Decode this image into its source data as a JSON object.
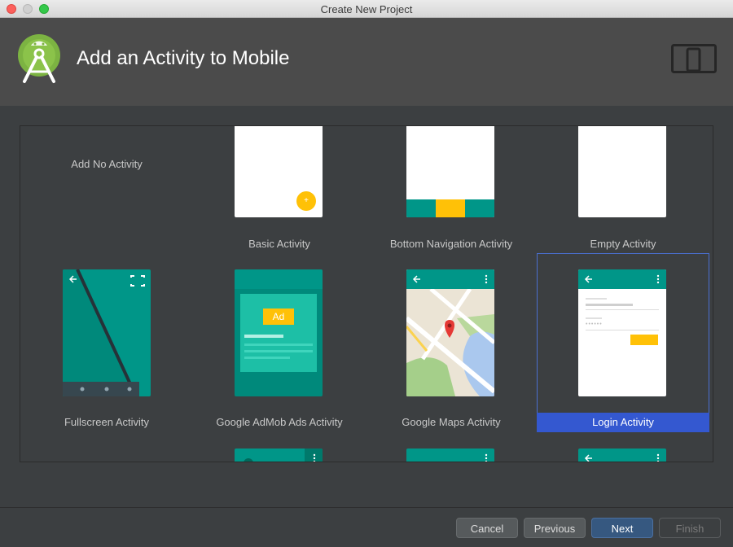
{
  "window": {
    "title": "Create New Project"
  },
  "header": {
    "title": "Add an Activity to Mobile"
  },
  "icons": {
    "app": "android-studio-icon",
    "device": "phone-tablet-icon"
  },
  "activities": [
    {
      "label": "Add No Activity"
    },
    {
      "label": "Basic Activity"
    },
    {
      "label": "Bottom Navigation Activity"
    },
    {
      "label": "Empty Activity"
    },
    {
      "label": "Fullscreen Activity"
    },
    {
      "label": "Google AdMob Ads Activity",
      "badge": "Ad"
    },
    {
      "label": "Google Maps Activity"
    },
    {
      "label": "Login Activity",
      "selected": true
    }
  ],
  "buttons": {
    "cancel": "Cancel",
    "previous": "Previous",
    "next": "Next",
    "finish": "Finish"
  },
  "colors": {
    "teal": "#009688",
    "accent": "#ffc107",
    "selection": "#3458d0",
    "panel": "#3c3f41"
  }
}
